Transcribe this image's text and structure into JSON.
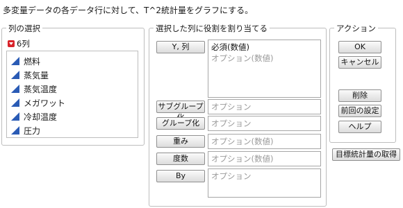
{
  "description": "多変量データの各データ行に対して、T^2統計量をグラフにする。",
  "column_selection": {
    "title": "列の選択",
    "count_label": "6列",
    "columns": [
      {
        "label": "燃料",
        "icon": "continuous-icon"
      },
      {
        "label": "蒸気量",
        "icon": "continuous-icon"
      },
      {
        "label": "蒸気温度",
        "icon": "continuous-icon"
      },
      {
        "label": "メガワット",
        "icon": "continuous-icon"
      },
      {
        "label": "冷却温度",
        "icon": "continuous-icon"
      },
      {
        "label": "圧力",
        "icon": "continuous-icon"
      }
    ]
  },
  "roles": {
    "title": "選択した列に役割を割り当てる",
    "items": [
      {
        "button": "Y, 列",
        "required": "必須(数値)",
        "placeholder": "オプション(数値)"
      },
      {
        "button": "サブグループ化",
        "placeholder": "オプション"
      },
      {
        "button": "グループ化",
        "placeholder": "オプション"
      },
      {
        "button": "重み",
        "placeholder": "オプション(数値)"
      },
      {
        "button": "度数",
        "placeholder": "オプション(数値)"
      },
      {
        "button": "By",
        "placeholder": "オプション"
      }
    ]
  },
  "actions": {
    "title": "アクション",
    "ok": "OK",
    "cancel": "キャンセル",
    "remove": "削除",
    "recall": "前回の設定",
    "help": "ヘルプ"
  },
  "target_stats_button": "目標統計量の取得",
  "colors": {
    "continuous_icon": "#2a5bb5",
    "red_triangle": "#d8232a",
    "border": "#bdbdbd"
  }
}
